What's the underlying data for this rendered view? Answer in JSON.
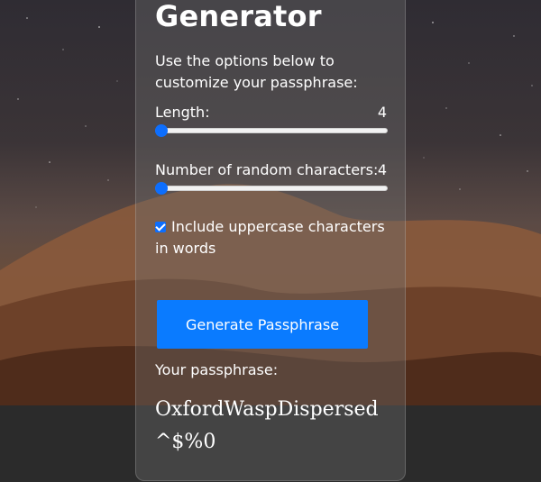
{
  "generator": {
    "title": "Generator",
    "intro": "Use the options below to customize your passphrase:",
    "length": {
      "label": "Length:",
      "value": "4",
      "fraction": 0
    },
    "random_chars": {
      "label": "Number of random characters:",
      "value": "4",
      "fraction": 0
    },
    "uppercase": {
      "label": "Include uppercase characters in words",
      "checked": true
    },
    "generate_button": "Generate Passphrase",
    "result_label": "Your passphrase:",
    "result_value": "OxfordWaspDispersed^$%0"
  },
  "colors": {
    "accent": "#0a7bff",
    "slider_thumb": "#0d6efd"
  }
}
